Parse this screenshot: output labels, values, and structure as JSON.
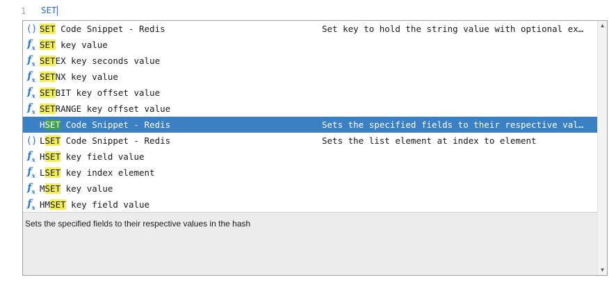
{
  "editor": {
    "line_number": "1",
    "line_text": "SET"
  },
  "colors": {
    "highlight": "#f2ee55",
    "selected_bg": "#3b80c2",
    "selected_highlight": "#3fa04b",
    "icon": "#2f7bd6"
  },
  "suggestions": [
    {
      "icon": "snippet-icon",
      "pre": "",
      "match": "SET",
      "post": " Code Snippet - Redis",
      "detail": "Set key to hold the string value with optional ex…"
    },
    {
      "icon": "function-icon",
      "pre": "",
      "match": "SET",
      "post": " key value",
      "detail": ""
    },
    {
      "icon": "function-icon",
      "pre": "",
      "match": "SET",
      "post": "EX key seconds value",
      "detail": ""
    },
    {
      "icon": "function-icon",
      "pre": "",
      "match": "SET",
      "post": "NX key value",
      "detail": ""
    },
    {
      "icon": "function-icon",
      "pre": "",
      "match": "SET",
      "post": "BIT key offset value",
      "detail": ""
    },
    {
      "icon": "function-icon",
      "pre": "",
      "match": "SET",
      "post": "RANGE key offset value",
      "detail": ""
    },
    {
      "icon": "snippet-icon",
      "pre": "H",
      "match": "SET",
      "post": " Code Snippet - Redis",
      "detail": "Sets the specified fields to their respective val…",
      "selected": true
    },
    {
      "icon": "snippet-icon",
      "pre": "L",
      "match": "SET",
      "post": " Code Snippet - Redis",
      "detail": "Sets the list element at index to element"
    },
    {
      "icon": "function-icon",
      "pre": "H",
      "match": "SET",
      "post": " key field value",
      "detail": ""
    },
    {
      "icon": "function-icon",
      "pre": "L",
      "match": "SET",
      "post": " key index element",
      "detail": ""
    },
    {
      "icon": "function-icon",
      "pre": "M",
      "match": "SET",
      "post": " key value",
      "detail": ""
    },
    {
      "icon": "function-icon",
      "pre": "HM",
      "match": "SET",
      "post": " key field value",
      "detail": ""
    }
  ],
  "doc_panel": {
    "text": "Sets the specified fields to their respective values in the hash"
  },
  "scrollbar": {
    "up_arrow": "▲",
    "down_arrow": "▼"
  }
}
